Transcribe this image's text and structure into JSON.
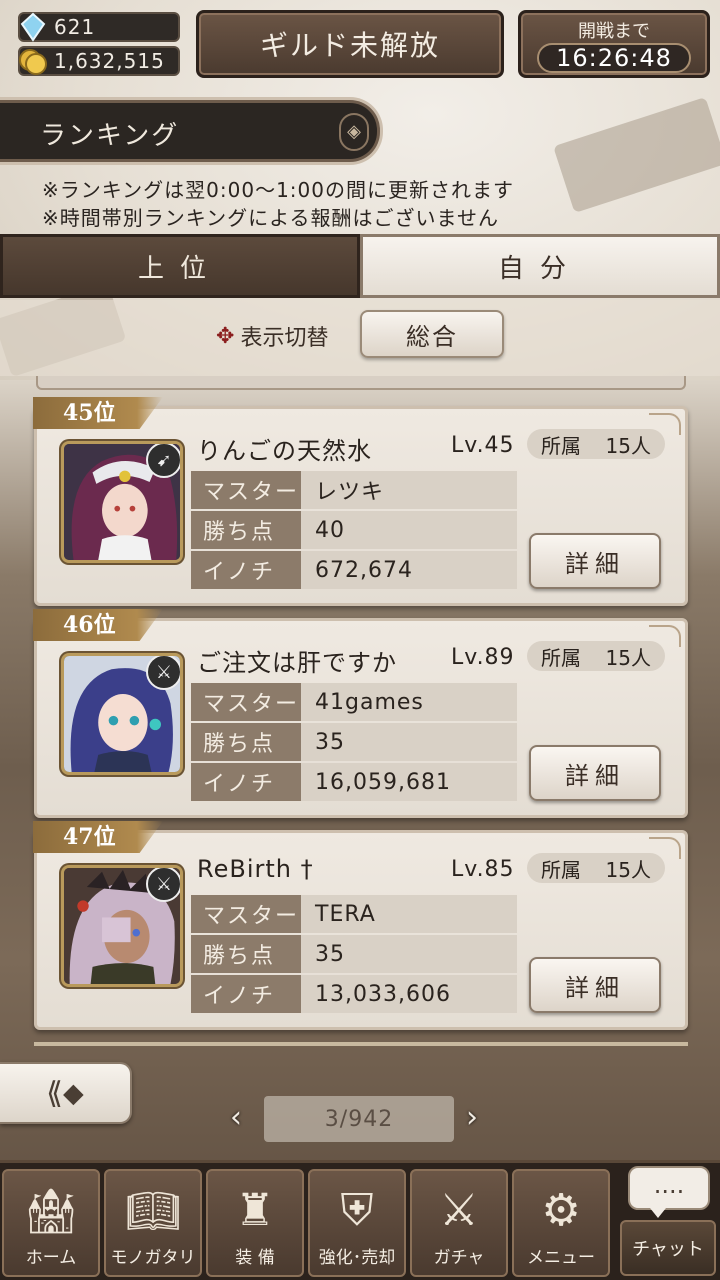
{
  "header": {
    "gems": "621",
    "gold": "1,632,515",
    "guild_button": "ギルド未解放",
    "battle_label": "開戦まで",
    "battle_time": "16:26:48"
  },
  "ranking": {
    "title": "ランキング",
    "notice1": "※ランキングは翌0:00〜1:00の間に更新されます",
    "notice2": "※時間帯別ランキングによる報酬はございません"
  },
  "tabs": {
    "top": "上位",
    "self": "自分"
  },
  "toggle": {
    "label": "表示切替",
    "value": "総合"
  },
  "stat_labels": {
    "master": "マスター",
    "points": "勝ち点",
    "life": "イノチ"
  },
  "member_label": "所属",
  "detail_label": "詳細",
  "entries": [
    {
      "rank": "45位",
      "name": "りんごの天然水",
      "level": "Lv.45",
      "members": "15人",
      "master": "レツキ",
      "points": "40",
      "life": "672,674",
      "type_icon": "bow-icon"
    },
    {
      "rank": "46位",
      "name": "ご注文は肝ですか",
      "level": "Lv.89",
      "members": "15人",
      "master": "41games",
      "points": "35",
      "life": "16,059,681",
      "type_icon": "sword-icon"
    },
    {
      "rank": "47位",
      "name": "ReBirth †",
      "level": "Lv.85",
      "members": "15人",
      "master": "TERA",
      "points": "35",
      "life": "13,033,606",
      "type_icon": "sword-icon"
    }
  ],
  "pager": {
    "text": "3/942"
  },
  "nav": {
    "home": "ホーム",
    "story": "モノガタリ",
    "equip": "装 備",
    "enhance": "強化･売却",
    "gacha": "ガチャ",
    "menu": "メニュー",
    "chat": "チャット",
    "chat_bubble": "...."
  }
}
